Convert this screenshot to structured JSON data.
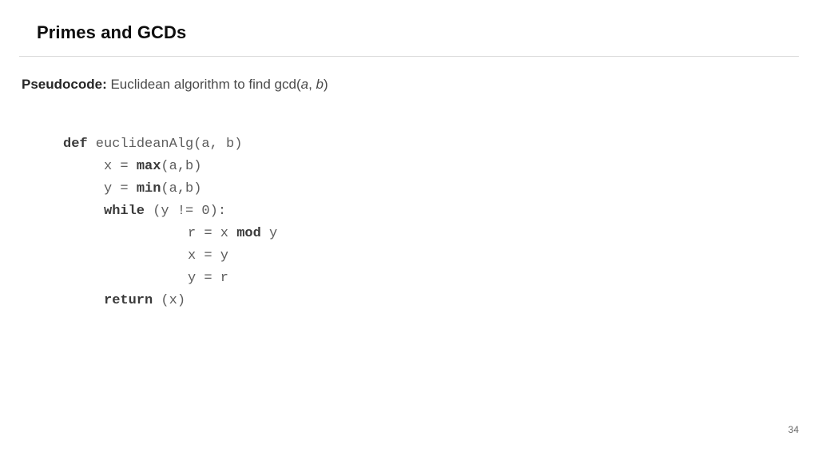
{
  "slide": {
    "title": "Primes and GCDs",
    "page_number": "34",
    "colors": {
      "background": "#ffffff",
      "title": "#0d0d0d",
      "rule": "#d9d9d9",
      "body_text": "#4a4a4a",
      "code_text": "#5d5d5d",
      "code_keyword": "#3a3a3a",
      "page_number": "#6b6b6b"
    }
  },
  "caption": {
    "lead": "Pseudocode:",
    "text_before_args": " Euclidean algorithm to find gcd(",
    "arg_a": "a",
    "arg_separator": ", ",
    "arg_b": "b",
    "text_after_args": ")"
  },
  "code": {
    "language": "pseudocode-python",
    "lines": [
      {
        "indent": 0,
        "segments": [
          {
            "text": "def",
            "bold": true
          },
          {
            "text": " euclideanAlg(a, b)",
            "bold": false
          }
        ]
      },
      {
        "indent": 1,
        "segments": [
          {
            "text": "x = ",
            "bold": false
          },
          {
            "text": "max",
            "bold": true
          },
          {
            "text": "(a,b)",
            "bold": false
          }
        ]
      },
      {
        "indent": 1,
        "segments": [
          {
            "text": "y = ",
            "bold": false
          },
          {
            "text": "min",
            "bold": true
          },
          {
            "text": "(a,b)",
            "bold": false
          }
        ]
      },
      {
        "indent": 1,
        "segments": [
          {
            "text": "while",
            "bold": true
          },
          {
            "text": " (y != 0):",
            "bold": false
          }
        ]
      },
      {
        "indent": 2,
        "segments": [
          {
            "text": "r = x ",
            "bold": false
          },
          {
            "text": "mod",
            "bold": true
          },
          {
            "text": " y",
            "bold": false
          }
        ]
      },
      {
        "indent": 2,
        "segments": [
          {
            "text": "x = y",
            "bold": false
          }
        ]
      },
      {
        "indent": 2,
        "segments": [
          {
            "text": "y = r",
            "bold": false
          }
        ]
      },
      {
        "indent": 1,
        "segments": [
          {
            "text": "return",
            "bold": true
          },
          {
            "text": " (x)",
            "bold": false
          }
        ]
      }
    ]
  }
}
